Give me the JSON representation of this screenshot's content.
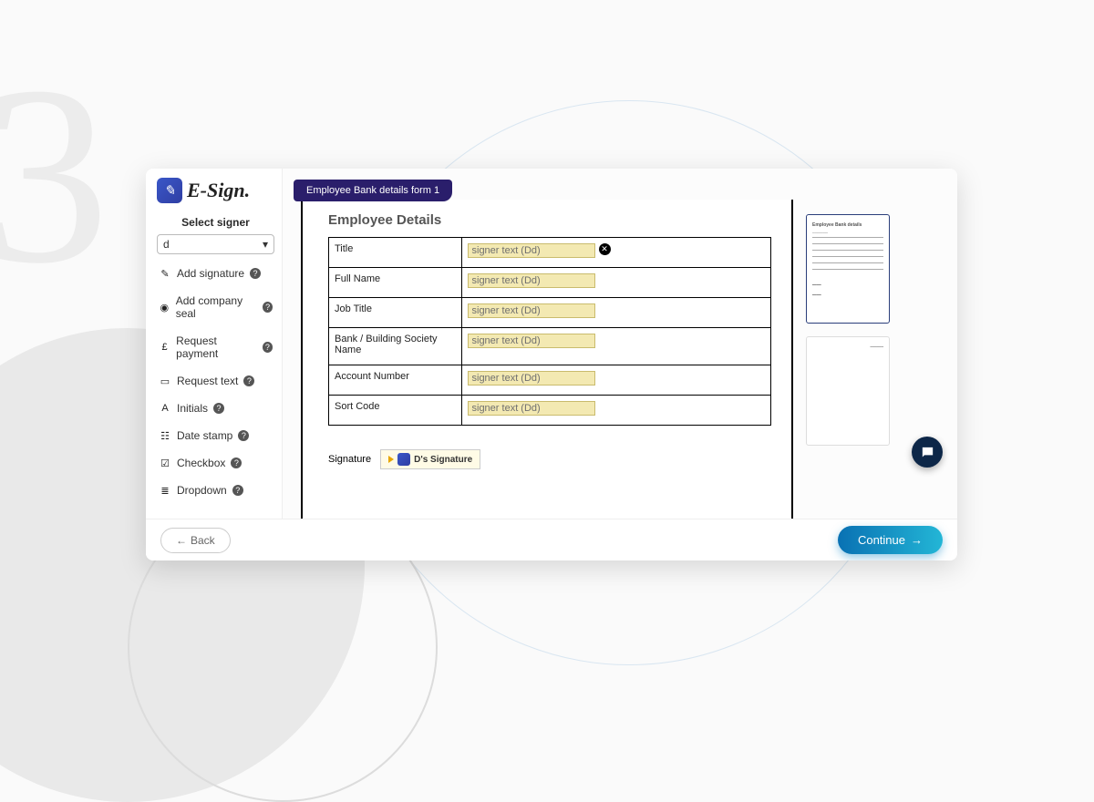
{
  "step_number": "3",
  "logo_text": "E-Sign.",
  "sidebar": {
    "select_signer_label": "Select signer",
    "selected_signer": "d",
    "tools": [
      {
        "icon": "✎",
        "label": "Add signature"
      },
      {
        "icon": "◉",
        "label": "Add company seal"
      },
      {
        "icon": "£",
        "label": "Request payment"
      },
      {
        "icon": "▭",
        "label": "Request text"
      },
      {
        "icon": "A",
        "label": "Initials"
      },
      {
        "icon": "☷",
        "label": "Date stamp"
      },
      {
        "icon": "☑",
        "label": "Checkbox"
      },
      {
        "icon": "≣",
        "label": "Dropdown"
      }
    ]
  },
  "document": {
    "tab_title": "Employee Bank details form 1",
    "section_heading": "Employee Details",
    "rows": [
      {
        "label": "Title",
        "placeholder": "signer text (Dd)",
        "show_close": true
      },
      {
        "label": "Full Name",
        "placeholder": "signer text (Dd)",
        "show_close": false
      },
      {
        "label": "Job Title",
        "placeholder": "signer text (Dd)",
        "show_close": false
      },
      {
        "label": "Bank / Building Society Name",
        "placeholder": "signer text (Dd)",
        "show_close": false
      },
      {
        "label": "Account Number",
        "placeholder": "signer text (Dd)",
        "show_close": false
      },
      {
        "label": "Sort Code",
        "placeholder": "signer text (Dd)",
        "show_close": false
      }
    ],
    "signature_label": "Signature",
    "signature_chip": "D's Signature"
  },
  "thumbnails": {
    "page1_title": "Employee Bank details"
  },
  "footer": {
    "back_label": "Back",
    "continue_label": "Continue"
  }
}
